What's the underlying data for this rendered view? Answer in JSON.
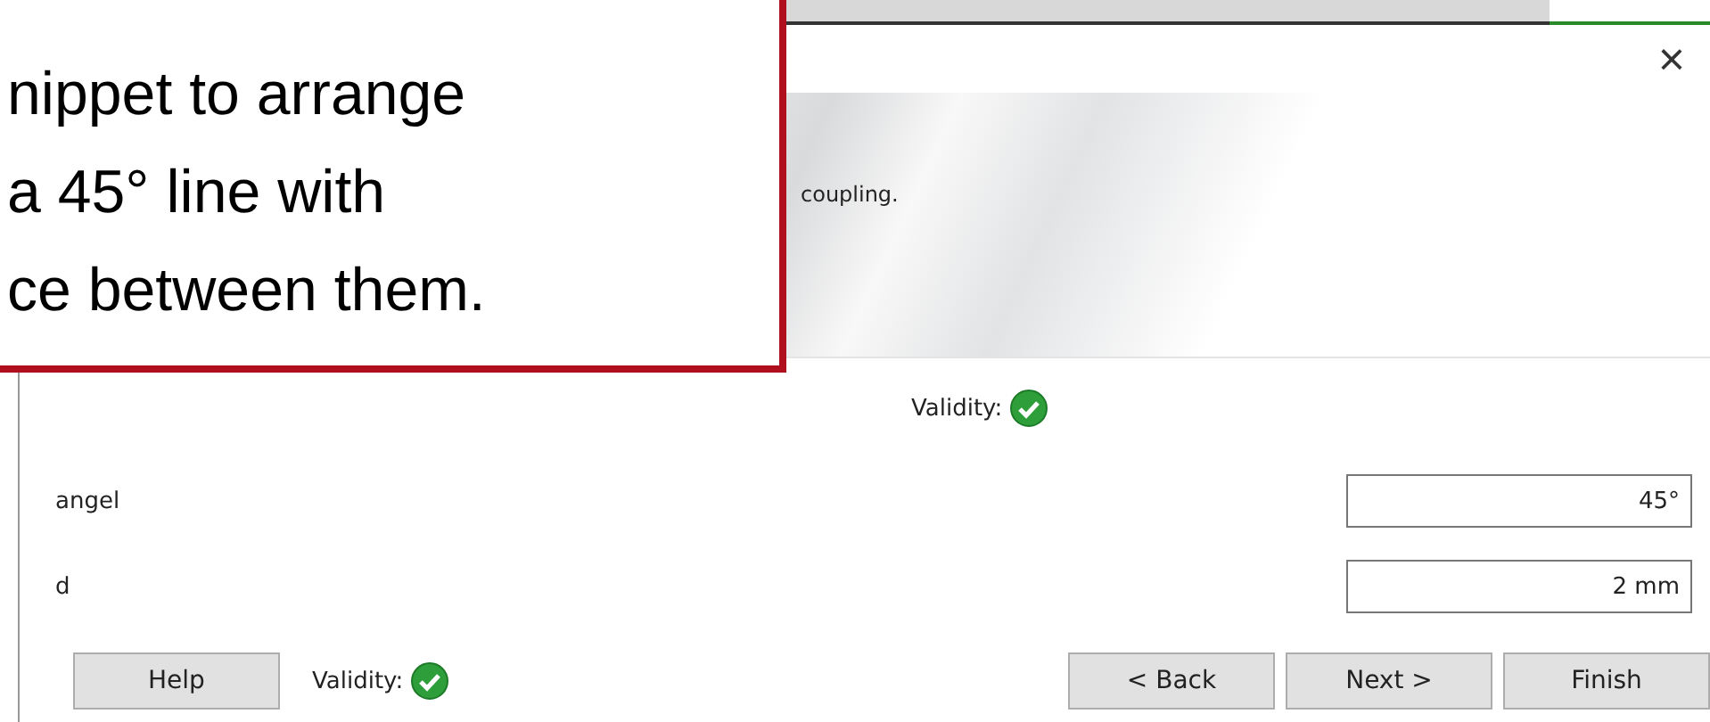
{
  "dialog": {
    "close": "×",
    "header": {
      "description": "coupling."
    },
    "toolbar": {
      "validity": {
        "label": "Validity:",
        "valid": true
      }
    },
    "parameters": [
      {
        "name": "angel",
        "value": "45°"
      },
      {
        "name": "d",
        "value": "2 mm"
      }
    ],
    "footer": {
      "help": "Help",
      "validity": {
        "label": "Validity:",
        "valid": true
      },
      "buttons": [
        "< Back",
        "Next >",
        "Finish"
      ]
    }
  },
  "callout": {
    "lines": [
      "nippet to arrange",
      "a 45° line with",
      "ce between them."
    ]
  }
}
